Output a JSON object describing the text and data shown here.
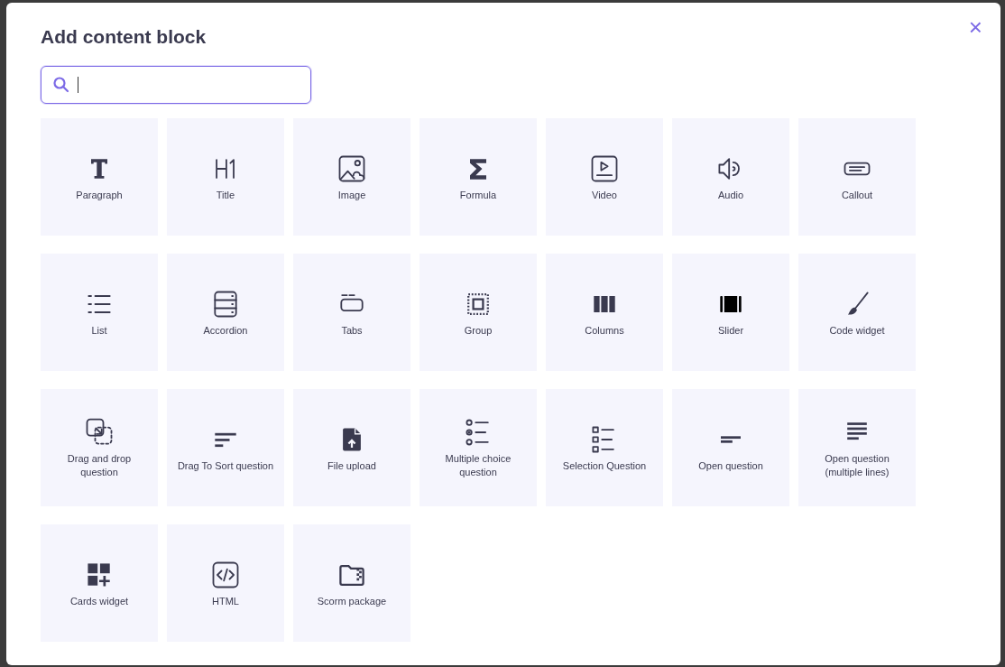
{
  "dialog": {
    "title": "Add content block",
    "close": "×"
  },
  "blocks": [
    {
      "label": "Paragraph"
    },
    {
      "label": "Title"
    },
    {
      "label": "Image"
    },
    {
      "label": "Formula"
    },
    {
      "label": "Video"
    },
    {
      "label": "Audio"
    },
    {
      "label": "Callout"
    },
    {
      "label": "List"
    },
    {
      "label": "Accordion"
    },
    {
      "label": "Tabs"
    },
    {
      "label": "Group"
    },
    {
      "label": "Columns"
    },
    {
      "label": "Slider"
    },
    {
      "label": "Code widget"
    },
    {
      "label": "Drag and drop question"
    },
    {
      "label": "Drag To Sort question"
    },
    {
      "label": "File upload"
    },
    {
      "label": "Multiple choice question"
    },
    {
      "label": "Selection Question"
    },
    {
      "label": "Open question"
    },
    {
      "label": "Open question (multiple lines)"
    },
    {
      "label": "Cards widget"
    },
    {
      "label": "HTML"
    },
    {
      "label": "Scorm package"
    }
  ]
}
